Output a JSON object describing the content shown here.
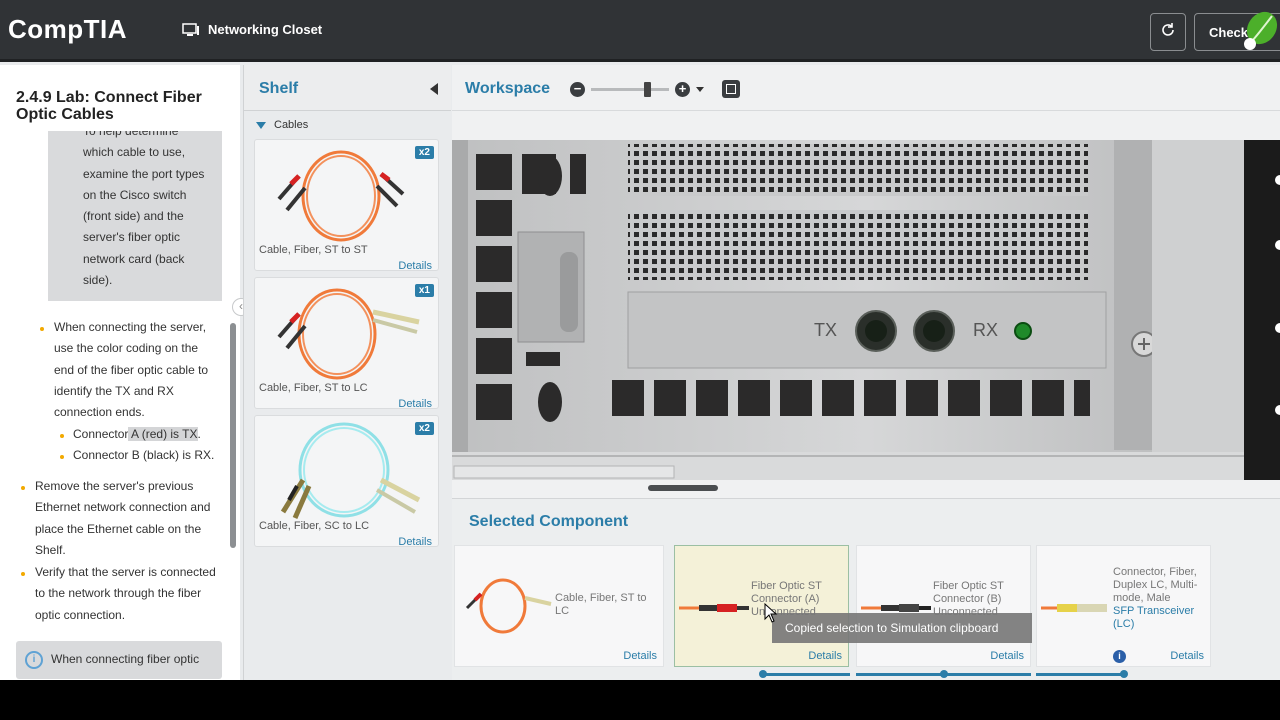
{
  "header": {
    "logo": "CompTIA",
    "lab_name": "Networking Closet",
    "check_label": "Check"
  },
  "instructions": {
    "title": "2.4.9 Lab: Connect Fiber Optic Cables",
    "tip_lines": [
      "To help determine",
      "which cable to use,",
      "examine the port types",
      "on the Cisco switch",
      "(front side) and the",
      "server's fiber optic",
      "network card (back",
      "side)."
    ],
    "bullet1_lines": [
      "When connecting the server,",
      "use the color coding on the",
      "end of the fiber optic cable to",
      "identify the TX and RX",
      "connection ends."
    ],
    "sub_a_prefix": "Connector",
    "sub_a_highlight": " A (red) is TX",
    "sub_a_suffix": ".",
    "sub_b": "Connector B (black) is RX.",
    "bullet2_lines": [
      "Remove the server's previous",
      "Ethernet network connection and",
      "place the Ethernet cable on the",
      "Shelf."
    ],
    "bullet3_lines": [
      "Verify that the server is connected",
      "to the network through the fiber",
      "optic connection."
    ],
    "note": "When connecting fiber optic"
  },
  "shelf": {
    "title": "Shelf",
    "group": "Cables",
    "items": [
      {
        "label": "Cable, Fiber, ST to ST",
        "qty": "x2",
        "details": "Details",
        "color": "#f07a3a"
      },
      {
        "label": "Cable, Fiber, ST to LC",
        "qty": "x1",
        "details": "Details",
        "color": "#f07a3a"
      },
      {
        "label": "Cable, Fiber, SC to LC",
        "qty": "x2",
        "details": "Details",
        "color": "#8fe0e6"
      }
    ]
  },
  "workspace": {
    "title": "Workspace",
    "tx_label": "TX",
    "rx_label": "RX"
  },
  "selected": {
    "title": "Selected Component",
    "cards": [
      {
        "line1": "Cable, Fiber, ST to LC",
        "details": "Details"
      },
      {
        "line1": "Fiber Optic ST",
        "line2": "Connector (A)",
        "line3": "Unconnected",
        "details": "Details"
      },
      {
        "line1": "Fiber Optic ST",
        "line2": "Connector (B)",
        "line3": "Unconnected",
        "details": "Details"
      },
      {
        "line1": "Connector, Fiber,",
        "line2": "Duplex LC, Multi-",
        "line3": "mode, Male",
        "line4": "SFP Transceiver",
        "line5": "(LC)",
        "details": "Details"
      }
    ],
    "tooltip": "Copied selection to Simulation clipboard"
  },
  "colors": {
    "accent": "#2b7da8",
    "bullet": "#f2a900",
    "topbar": "#303336"
  }
}
